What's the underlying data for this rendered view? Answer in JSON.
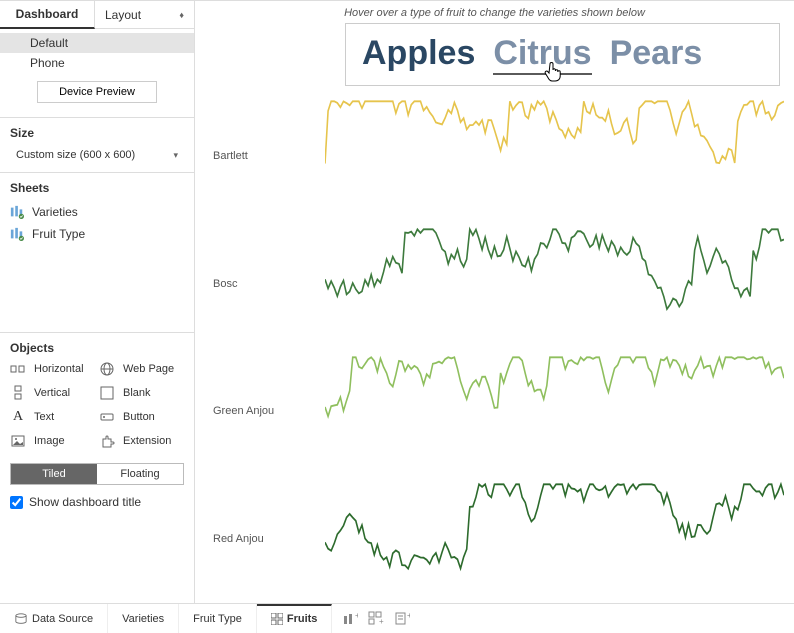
{
  "tabs": {
    "dashboard": "Dashboard",
    "layout": "Layout"
  },
  "devices": {
    "default": "Default",
    "phone": "Phone",
    "preview_btn": "Device Preview"
  },
  "size": {
    "title": "Size",
    "value": "Custom size (600 x 600)"
  },
  "sheets": {
    "title": "Sheets",
    "items": [
      "Varieties",
      "Fruit Type"
    ]
  },
  "objects": {
    "title": "Objects",
    "items": [
      {
        "label": "Horizontal"
      },
      {
        "label": "Web Page"
      },
      {
        "label": "Vertical"
      },
      {
        "label": "Blank"
      },
      {
        "label": "Text"
      },
      {
        "label": "Button"
      },
      {
        "label": "Image"
      },
      {
        "label": "Extension"
      }
    ],
    "tiled": "Tiled",
    "floating": "Floating"
  },
  "show_title": "Show dashboard title",
  "canvas": {
    "hover_note": "Hover over a type of fruit to change the varieties shown below",
    "fruits": {
      "apples": "Apples",
      "citrus": "Citrus",
      "pears": "Pears"
    },
    "varieties": [
      "Bartlett",
      "Bosc",
      "Green Anjou",
      "Red Anjou"
    ]
  },
  "bottom": {
    "data_source": "Data Source",
    "tabs": [
      "Varieties",
      "Fruit Type",
      "Fruits"
    ]
  },
  "chart_data": [
    {
      "type": "line",
      "title": "Bartlett",
      "color": "#e6c44c",
      "ylim": [
        0,
        100
      ],
      "n_points": 150
    },
    {
      "type": "line",
      "title": "Bosc",
      "color": "#3d7a3d",
      "ylim": [
        0,
        100
      ],
      "n_points": 150
    },
    {
      "type": "line",
      "title": "Green Anjou",
      "color": "#8fbf5e",
      "ylim": [
        0,
        100
      ],
      "n_points": 150
    },
    {
      "type": "line",
      "title": "Red Anjou",
      "color": "#2d6b2d",
      "ylim": [
        0,
        100
      ],
      "n_points": 150
    }
  ]
}
